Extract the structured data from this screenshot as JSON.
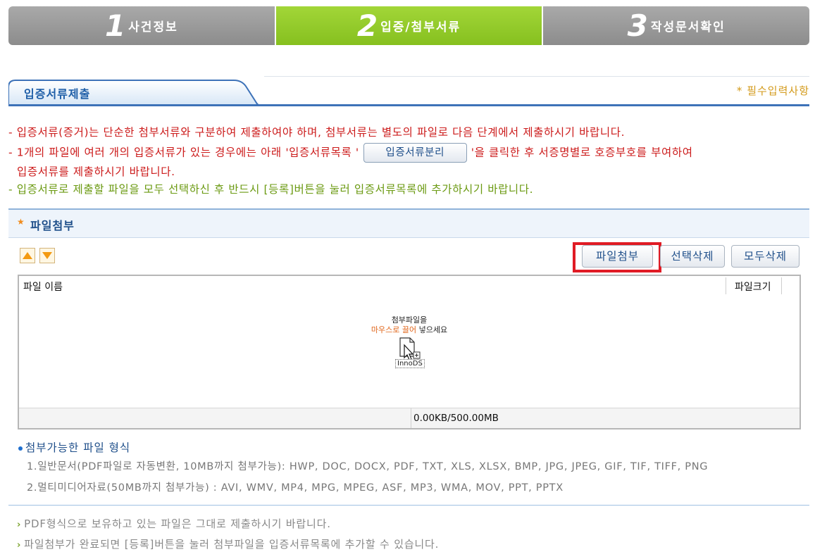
{
  "steps": [
    {
      "num": "1",
      "label": "사건정보"
    },
    {
      "num": "2",
      "label": "입증/첨부서류"
    },
    {
      "num": "3",
      "label": "작성문서확인"
    }
  ],
  "section": {
    "title": "입증서류제출",
    "required_note": "* 필수입력사항"
  },
  "notices": {
    "line1": "- 입증서류(증거)는 단순한 첨부서류와 구분하여 제출하여야 하며, 첨부서류는 별도의 파일로 다음 단계에서 제출하시기 바랍니다.",
    "line2_pre": "- 1개의 파일에 여러 개의 입증서류가 있는 경우에는 아래 '입증서류목록 '",
    "split_button": "입증서류분리",
    "line2_post": "'을 클릭한 후 서증명별로 호증부호를 부여하여",
    "line3": "입증서류를 제출하시기 바랍니다.",
    "line4": "- 입증서류로 제출할 파일을 모두 선택하신 후 반드시 [등록]버튼을 눌러 입증서류목록에 추가하시기 바랍니다."
  },
  "attach": {
    "title": "파일첨부",
    "star": "★"
  },
  "toolbar": {
    "up_icon": "arrow-up-icon",
    "down_icon": "arrow-down-icon",
    "attach_button": "파일첨부",
    "delete_selected_button": "선택삭제",
    "delete_all_button": "모두삭제"
  },
  "file_list": {
    "col_name": "파일 이름",
    "col_size": "파일크기",
    "drop_hint_line1": "첨부파일을",
    "drop_hint_drag": "마우스로 끌어",
    "drop_hint_put": "넣으세요",
    "drop_icon_label": "InnoDS",
    "usage": "0.00KB/500.00MB"
  },
  "formats": {
    "title": "첨부가능한 파일 형식",
    "line1": "1.일반문서(PDF파일로 자동변환, 10MB까지 첨부가능): HWP, DOC, DOCX, PDF, TXT, XLS, XLSX, BMP, JPG, JPEG, GIF, TIF, TIFF, PNG",
    "line2": "2.멀티미디어자료(50MB까지 첨부가능) : AVI, WMV, MP4, MPG, MPEG, ASF, MP3, WMA, MOV, PPT, PPTX"
  },
  "tips": [
    "PDF형식으로 보유하고 있는 파일은 그대로 제출하시기 바랍니다.",
    "파일첨부가 완료되면 [등록]버튼을 눌러 첨부파일을 입증서류목록에 추가할 수 있습니다."
  ],
  "colors": {
    "active_step": "#8cc63f",
    "inactive_step": "#9a9a9a",
    "highlight": "#e01b24"
  }
}
